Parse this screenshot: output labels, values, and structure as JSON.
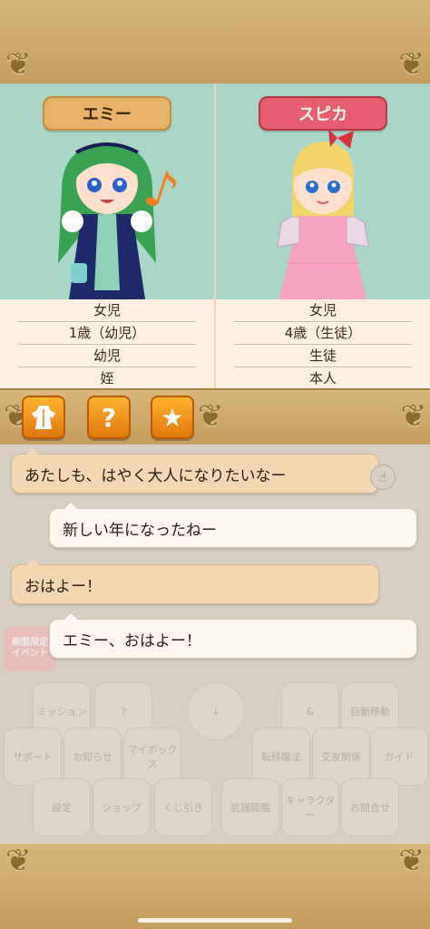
{
  "characters": [
    {
      "name": "エミー",
      "info": [
        "女児",
        "1歳（幼児）",
        "幼児",
        "姪"
      ]
    },
    {
      "name": "スピカ",
      "info": [
        "女児",
        "4歳（生徒）",
        "生徒",
        "本人"
      ]
    }
  ],
  "toolbar": {
    "outfit_icon": "dress-icon",
    "help_icon": "question-icon",
    "favorite_icon": "star-icon"
  },
  "chat": {
    "messages": [
      {
        "text": "あたしも、はやく大人になりたいなー",
        "style": "tan"
      },
      {
        "text": "新しい年になったねー",
        "style": "white"
      },
      {
        "text": "おはよー！",
        "style": "tan"
      },
      {
        "text": "エミー、おはよー！",
        "style": "white"
      }
    ]
  },
  "background_menu": {
    "event_badge": "期間限定\nイベント",
    "items": [
      "ミッション",
      "?",
      "↓",
      "&",
      "自動移動",
      "サポート",
      "お知らせ",
      "マイボックス",
      "転移魔法",
      "交友関係",
      "ガイド",
      "設定",
      "ショップ",
      "くじ引き",
      "武器図鑑",
      "キャラクター",
      "お問合せ"
    ]
  },
  "colors": {
    "panel_bg": "#a9d6c6",
    "emi_plate": "#e7b36a",
    "spica_plate": "#e65f6e",
    "tool_button": "#f39a1e"
  }
}
